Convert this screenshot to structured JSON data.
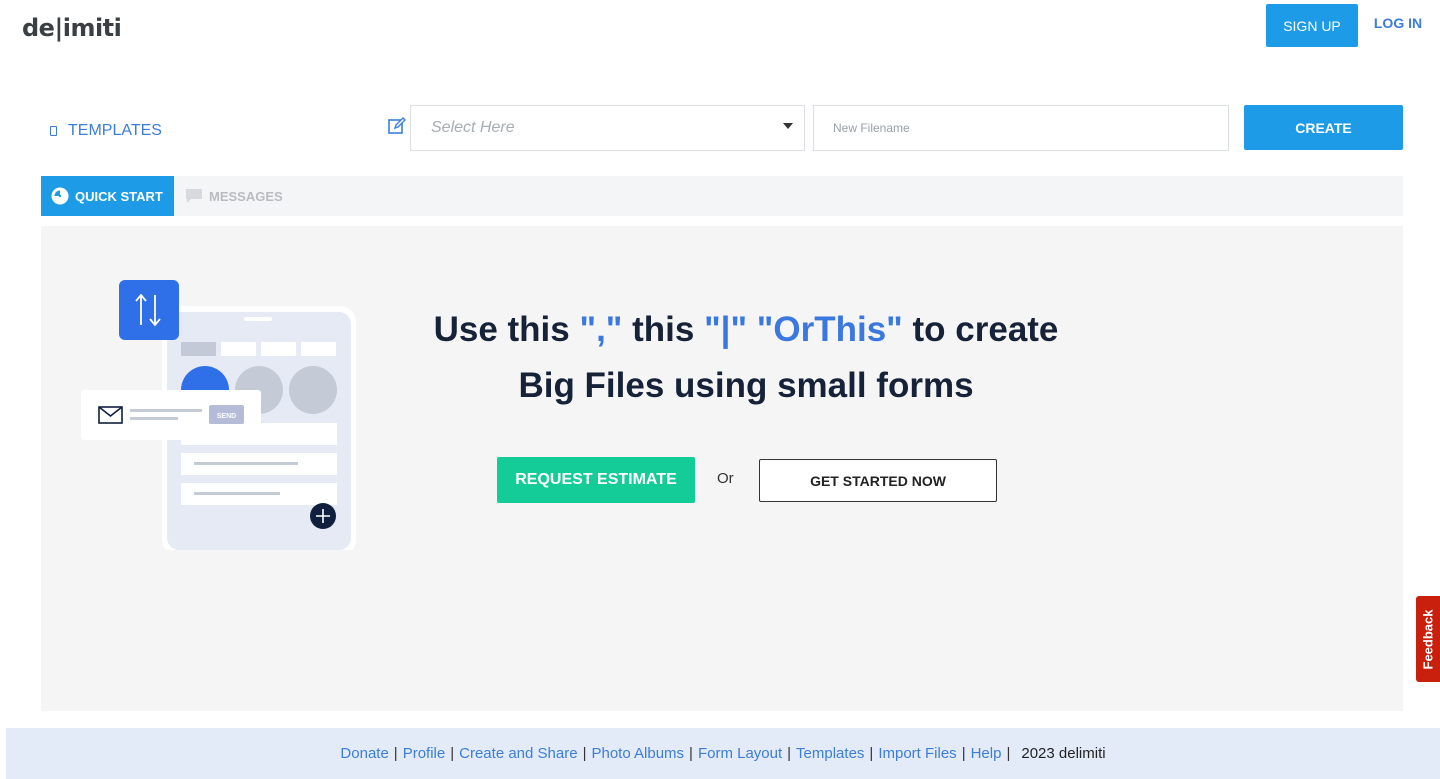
{
  "header": {
    "logo": "de|imiti",
    "signup_label": "SIGN UP",
    "login_label": "LOG IN"
  },
  "toolbar": {
    "templates_label": "TEMPLATES",
    "select_placeholder": "Select Here",
    "filename_placeholder": "New Filename",
    "create_label": "CREATE"
  },
  "tabs": [
    {
      "label": "QUICK START",
      "icon": "clock-icon",
      "active": true
    },
    {
      "label": "MESSAGES",
      "icon": "chat-icon",
      "active": false
    }
  ],
  "hero": {
    "line1_a": "Use this ",
    "line1_b": "\",\"",
    "line1_c": " this ",
    "line1_d": "\"|\"",
    "line1_e": " ",
    "line1_f": "\"OrThis\"",
    "line1_g": " to create",
    "line2": "Big Files using small forms",
    "send_label": "SEND",
    "estimate_label": "REQUEST ESTIMATE",
    "or_label": "Or",
    "started_label": "GET STARTED NOW"
  },
  "feedback_label": "Feedback",
  "footer": {
    "links": [
      "Donate",
      "Profile",
      "Create and Share",
      "Photo Albums",
      "Form Layout",
      "Templates",
      "Import Files",
      "Help"
    ],
    "copyright": "2023 delimiti"
  },
  "colors": {
    "primary": "#1e9be6",
    "accent_green": "#13cc97",
    "link_blue": "#3c7dd9",
    "feedback_red": "#c9200e",
    "headline_dark": "#152238"
  }
}
